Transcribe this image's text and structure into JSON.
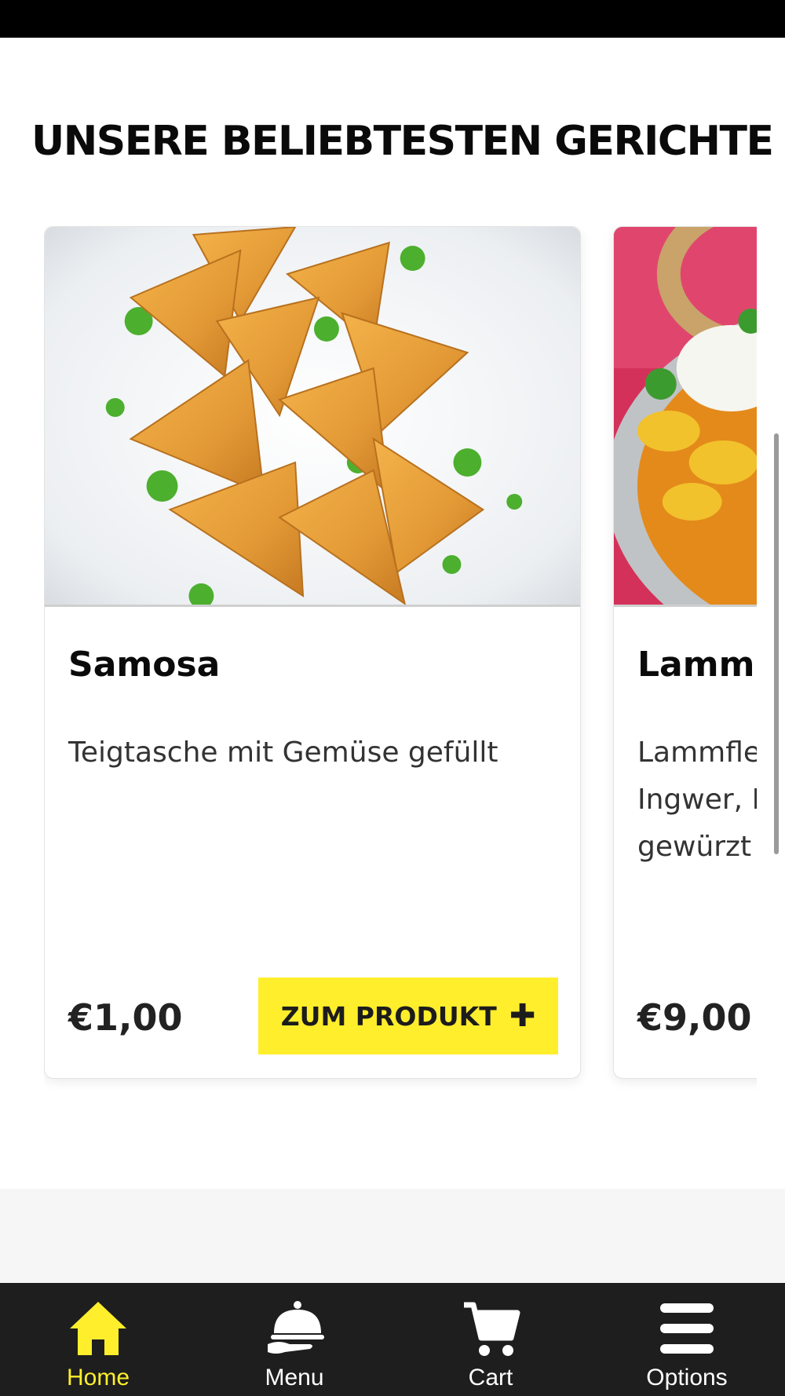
{
  "section": {
    "title": "UNSERE BELIEBTESTEN GERICHTE"
  },
  "products": [
    {
      "name": "Samosa",
      "description": "Teigtasche mit Gemüse gefüllt",
      "price": "€1,00",
      "button_label": "ZUM PRODUKT",
      "button_icon": "plus-icon",
      "image": "samosa-photo"
    },
    {
      "name": "Lamm",
      "description": "Lammfle\nIngwer, I\ngewürzt",
      "price": "€9,00",
      "image": "lamb-curry-photo"
    }
  ],
  "nav": {
    "items": [
      {
        "label": "Home",
        "icon": "home-icon",
        "active": true
      },
      {
        "label": "Menu",
        "icon": "cloche-icon",
        "active": false
      },
      {
        "label": "Cart",
        "icon": "cart-icon",
        "active": false
      },
      {
        "label": "Options",
        "icon": "hamburger-menu-icon",
        "active": false
      }
    ]
  },
  "colors": {
    "accent": "#ffee2c",
    "nav_background": "#1e1e1e",
    "status_bar": "#000000"
  }
}
